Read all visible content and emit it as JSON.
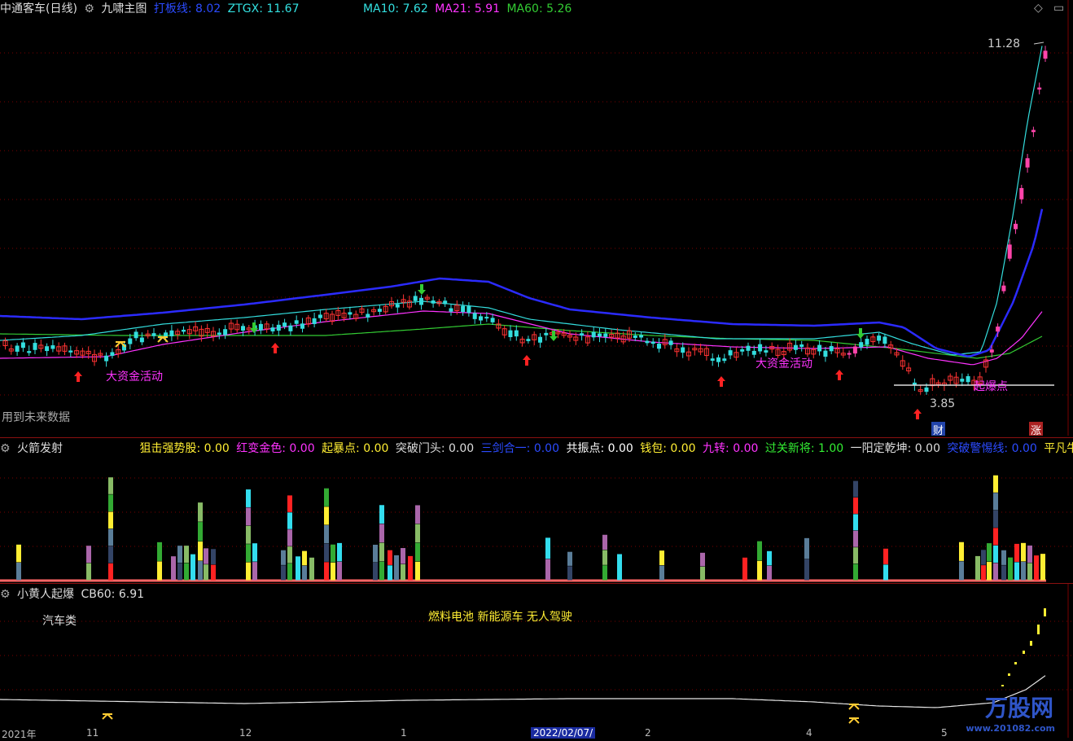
{
  "main": {
    "stock_name": "中通客车(日线)",
    "chart_name": "九啸主图",
    "indicators": [
      {
        "label": "打板线: 8.02",
        "color": "#2b4bff"
      },
      {
        "label": "ZTGX: 11.67",
        "color": "#33e0e0"
      },
      {
        "label": "MA10: 7.62",
        "color": "#33e0e0"
      },
      {
        "label": "MA21: 5.91",
        "color": "#ff33ff"
      },
      {
        "label": "MA60: 5.26",
        "color": "#33cc33"
      }
    ],
    "high_label": "11.28",
    "low_label": "3.85",
    "future_data_note": "用到未来数据",
    "annotation_1": "大资金活动",
    "annotation_2": "大资金活动",
    "annotation_3": "起爆点",
    "badge_cai": "财",
    "badge_zhang": "涨"
  },
  "ind1": {
    "name": "火箭发射",
    "items": [
      {
        "label": "狙击强势股: 0.00",
        "color": "#ffee33"
      },
      {
        "label": "红变金色: 0.00",
        "color": "#ff33ff"
      },
      {
        "label": "起暴点: 0.00",
        "color": "#ffee33"
      },
      {
        "label": "突破门头: 0.00",
        "color": "#dddddd"
      },
      {
        "label": "三剑合一: 0.00",
        "color": "#2b4bff"
      },
      {
        "label": "共振点: 0.00",
        "color": "#ffffff"
      },
      {
        "label": "钱包: 0.00",
        "color": "#ffee33"
      },
      {
        "label": "九转: 0.00",
        "color": "#ff33ff"
      },
      {
        "label": "过关新将: 1.00",
        "color": "#33ee33"
      },
      {
        "label": "一阳定乾坤: 0.00",
        "color": "#dddddd"
      },
      {
        "label": "突破警惕线: 0.00",
        "color": "#2b4bff"
      },
      {
        "label": "平凡牛",
        "color": "#ffee33"
      }
    ]
  },
  "ind2": {
    "name": "小黄人起爆",
    "value": "CB60: 6.91",
    "category": "汽车类",
    "concepts": "燃料电池 新能源车 无人驾驶"
  },
  "axis": {
    "dates": [
      "2021年",
      "11",
      "12",
      "1",
      "2022/02/07/",
      "2",
      "4",
      "5"
    ]
  },
  "watermark": {
    "brand": "万股网",
    "url": "www.201082.com"
  },
  "colors": {
    "up": "#ff3333",
    "down": "#33dddd",
    "grid": "#7a0000",
    "ma_blue": "#2b2bff",
    "ma_cyan": "#33dddd",
    "ma_pink": "#ff33ff",
    "ma_green": "#33cc33"
  }
}
